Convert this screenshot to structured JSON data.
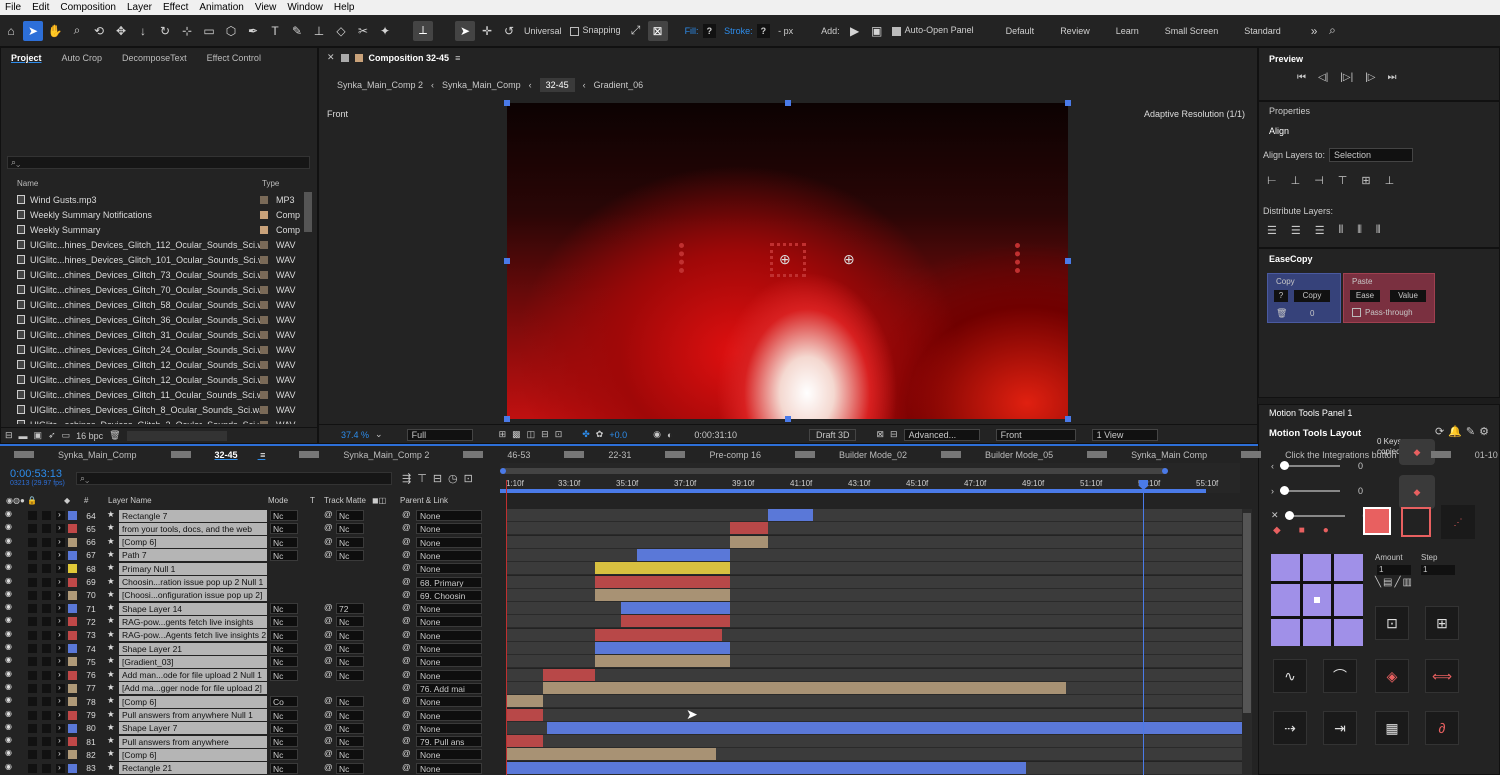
{
  "menu": [
    "File",
    "Edit",
    "Composition",
    "Layer",
    "Effect",
    "Animation",
    "View",
    "Window",
    "Help"
  ],
  "toolbar": {
    "universal": "Universal",
    "snapping": "Snapping",
    "fill_label": "Fill:",
    "fill_val": "?",
    "stroke_label": "Stroke:",
    "stroke_val": "?",
    "stroke_unit": "- px",
    "add_label": "Add:",
    "auto_open": "Auto-Open Panel",
    "workspaces": [
      "Default",
      "Review",
      "Learn",
      "Small Screen",
      "Standard"
    ],
    "more": "»"
  },
  "project": {
    "tabs": [
      "Project",
      "Auto Crop",
      "DecomposeText",
      "Effect Control"
    ],
    "search_icon": "search-icon",
    "col_name": "Name",
    "col_type": "Type",
    "items": [
      {
        "name": "Wind Gusts.mp3",
        "type": "MP3",
        "color": "#7a6a58"
      },
      {
        "name": "Weekly Summary Notifications",
        "type": "Comp",
        "color": "#c9a27a"
      },
      {
        "name": "Weekly Summary",
        "type": "Comp",
        "color": "#c9a27a"
      },
      {
        "name": "UIGlitc...hines_Devices_Glitch_112_Ocular_Sounds_Sci.wav",
        "type": "WAV",
        "color": "#7a6a58"
      },
      {
        "name": "UIGlitc...hines_Devices_Glitch_101_Ocular_Sounds_Sci.wav",
        "type": "WAV",
        "color": "#7a6a58"
      },
      {
        "name": "UIGlitc...chines_Devices_Glitch_73_Ocular_Sounds_Sci.wav",
        "type": "WAV",
        "color": "#7a6a58"
      },
      {
        "name": "UIGlitc...chines_Devices_Glitch_70_Ocular_Sounds_Sci.wav",
        "type": "WAV",
        "color": "#7a6a58"
      },
      {
        "name": "UIGlitc...chines_Devices_Glitch_58_Ocular_Sounds_Sci.wav",
        "type": "WAV",
        "color": "#7a6a58"
      },
      {
        "name": "UIGlitc...chines_Devices_Glitch_36_Ocular_Sounds_Sci.wav",
        "type": "WAV",
        "color": "#7a6a58"
      },
      {
        "name": "UIGlitc...chines_Devices_Glitch_31_Ocular_Sounds_Sci.wav",
        "type": "WAV",
        "color": "#7a6a58"
      },
      {
        "name": "UIGlitc...chines_Devices_Glitch_24_Ocular_Sounds_Sci.wav",
        "type": "WAV",
        "color": "#7a6a58"
      },
      {
        "name": "UIGlitc...chines_Devices_Glitch_12_Ocular_Sounds_Sci.wav",
        "type": "WAV",
        "color": "#7a6a58"
      },
      {
        "name": "UIGlitc...chines_Devices_Glitch_12_Ocular_Sounds_Sci.wav",
        "type": "WAV",
        "color": "#7a6a58"
      },
      {
        "name": "UIGlitc...chines_Devices_Glitch_11_Ocular_Sounds_Sci.wav",
        "type": "WAV",
        "color": "#7a6a58"
      },
      {
        "name": "UIGlitc...chines_Devices_Glitch_8_Ocular_Sounds_Sci.wav",
        "type": "WAV",
        "color": "#7a6a58"
      },
      {
        "name": "UIGlitc...achines_Devices_Glitch_2_Ocular_Sounds_Sci.wav",
        "type": "WAV",
        "color": "#7a6a58"
      },
      {
        "name": "UIGlitc...achines_Devices_Glitch_2_Ocular_Sounds_Sci.wav",
        "type": "WAV",
        "color": "#7a6a58"
      }
    ],
    "bpc": "16 bpc"
  },
  "comp": {
    "title": "Composition 32-45",
    "breadcrumbs": [
      "Synka_Main_Comp 2",
      "Synka_Main_Comp",
      "32-45",
      "Gradient_06"
    ],
    "view_label": "Front",
    "resolution": "Adaptive Resolution (1/1)",
    "zoom": "37.4 %",
    "quality": "Full",
    "exposure": "+0.0",
    "timecode": "0:00:31:10",
    "renderer": "Draft 3D",
    "advanced": "Advanced...",
    "camera": "Front",
    "views": "1 View"
  },
  "timeline": {
    "tabs": [
      "Synka_Main_Comp",
      "32-45",
      "Synka_Main_Comp 2",
      "46-53",
      "22-31",
      "Pre-comp 16",
      "Builder Mode_02",
      "Builder Mode_05",
      "Synka_Main Comp",
      "Click the Integrations button",
      "01-10"
    ],
    "timecode": "0:00:53:13",
    "fps": "03213 (29.97 fps)",
    "col_layer": "Layer Name",
    "col_mode": "Mode",
    "col_t": "T",
    "col_matte": "Track Matte",
    "col_parent": "Parent & Link",
    "ticks": [
      "1:10f",
      "33:10f",
      "35:10f",
      "37:10f",
      "39:10f",
      "41:10f",
      "43:10f",
      "45:10f",
      "47:10f",
      "49:10f",
      "51:10f",
      "53:10f",
      "55:10f"
    ],
    "layers": [
      {
        "num": "64",
        "name": "Rectangle 7",
        "color": "#5a78d8",
        "mode": "Nc",
        "matte": "Nc",
        "parent": "None",
        "bar": [
          262,
          307
        ],
        "barc": "#5a78d8"
      },
      {
        "num": "65",
        "name": "from your tools, docs, and the web",
        "color": "#c04848",
        "mode": "Nc",
        "matte": "Nc",
        "parent": "None",
        "bar": [
          224,
          262
        ],
        "barc": "#b84848"
      },
      {
        "num": "66",
        "name": "[Comp 6]",
        "color": "#b09a78",
        "mode": "Nc",
        "matte": "Nc",
        "parent": "None",
        "bar": [
          224,
          262
        ],
        "barc": "#a89274"
      },
      {
        "num": "67",
        "name": "Path 7",
        "color": "#5a78d8",
        "mode": "Nc",
        "matte": "Nc",
        "parent": "None",
        "bar": [
          131,
          224
        ],
        "barc": "#5a78d8"
      },
      {
        "num": "68",
        "name": "Primary Null 1",
        "color": "#e0c838",
        "mode": "",
        "matte": "",
        "parent": "None",
        "bar": [
          89,
          224
        ],
        "barc": "#d8c040"
      },
      {
        "num": "69",
        "name": "Choosin...ration issue pop up 2 Null 1",
        "color": "#c04848",
        "mode": "",
        "matte": "",
        "parent": "68. Primary",
        "bar": [
          89,
          224
        ],
        "barc": "#b84848"
      },
      {
        "num": "70",
        "name": "[Choosi...onfiguration issue pop up 2]",
        "color": "#b09a78",
        "mode": "",
        "matte": "",
        "parent": "69. Choosin",
        "bar": [
          89,
          224
        ],
        "barc": "#a89274"
      },
      {
        "num": "71",
        "name": "Shape Layer 14",
        "color": "#5a78d8",
        "mode": "Nc",
        "matte": "72",
        "parent": "None",
        "bar": [
          115,
          224
        ],
        "barc": "#5a78d8"
      },
      {
        "num": "72",
        "name": "RAG-pow...gents fetch live insights",
        "color": "#c04848",
        "mode": "Nc",
        "matte": "Nc",
        "parent": "None",
        "bar": [
          115,
          224
        ],
        "barc": "#b84848"
      },
      {
        "num": "73",
        "name": "RAG-pow...Agents fetch live insights 2",
        "color": "#c04848",
        "mode": "Nc",
        "matte": "Nc",
        "parent": "None",
        "bar": [
          89,
          216
        ],
        "barc": "#b84848"
      },
      {
        "num": "74",
        "name": "Shape Layer 21",
        "color": "#5a78d8",
        "mode": "Nc",
        "matte": "Nc",
        "parent": "None",
        "bar": [
          89,
          224
        ],
        "barc": "#5a78d8"
      },
      {
        "num": "75",
        "name": "[Gradient_03]",
        "color": "#b09a78",
        "mode": "Nc",
        "matte": "Nc",
        "parent": "None",
        "bar": [
          89,
          224
        ],
        "barc": "#a89274"
      },
      {
        "num": "76",
        "name": "Add man...ode for file upload 2 Null 1",
        "color": "#c04848",
        "mode": "Nc",
        "matte": "Nc",
        "parent": "None",
        "bar": [
          37,
          89
        ],
        "barc": "#b84848"
      },
      {
        "num": "77",
        "name": "[Add ma...gger node for file upload 2]",
        "color": "#b09a78",
        "mode": "",
        "matte": "",
        "parent": "76. Add mai",
        "bar": [
          37,
          560
        ],
        "barc": "#a89274"
      },
      {
        "num": "78",
        "name": "[Comp 6]",
        "color": "#b09a78",
        "mode": "Co",
        "matte": "Nc",
        "parent": "None",
        "bar": [
          0,
          37
        ],
        "barc": "#a89274"
      },
      {
        "num": "79",
        "name": "Pull answers from anywhere Null 1",
        "color": "#c04848",
        "mode": "Nc",
        "matte": "Nc",
        "parent": "None",
        "bar": [
          0,
          37
        ],
        "barc": "#b84848"
      },
      {
        "num": "80",
        "name": "Shape Layer 7",
        "color": "#5a78d8",
        "mode": "Nc",
        "matte": "Nc",
        "parent": "None",
        "bar": [
          41,
          736
        ],
        "barc": "#5a78d8"
      },
      {
        "num": "81",
        "name": "Pull answers from anywhere",
        "color": "#c04848",
        "mode": "Nc",
        "matte": "Nc",
        "parent": "79. Pull ans",
        "bar": [
          0,
          37
        ],
        "barc": "#b84848"
      },
      {
        "num": "82",
        "name": "[Comp 6]",
        "color": "#b09a78",
        "mode": "Nc",
        "matte": "Nc",
        "parent": "None",
        "bar": [
          0,
          210
        ],
        "barc": "#a89274"
      },
      {
        "num": "83",
        "name": "Rectangle 21",
        "color": "#5a78d8",
        "mode": "Nc",
        "matte": "Nc",
        "parent": "None",
        "bar": [
          0,
          520
        ],
        "barc": "#5a78d8"
      }
    ]
  },
  "preview": {
    "title": "Preview"
  },
  "properties": {
    "title": "Properties",
    "align_title": "Align",
    "align_layers_to": "Align Layers to:",
    "align_target": "Selection",
    "distribute": "Distribute Layers:"
  },
  "easecopy": {
    "title": "EaseCopy",
    "copy_head": "Copy",
    "q": "?",
    "copy_btn": "Copy",
    "count": "0",
    "paste_head": "Paste",
    "ease_btn": "Ease",
    "value_btn": "Value",
    "pass": "Pass-through"
  },
  "motion": {
    "panel_title": "Motion Tools Panel 1",
    "layout_title": "Motion Tools Layout",
    "keys": "0 Keys",
    "copied": "copied",
    "sliders": [
      "0",
      "0",
      "0"
    ],
    "amount_label": "Amount",
    "step_label": "Step",
    "amount": "1",
    "step": "1"
  }
}
